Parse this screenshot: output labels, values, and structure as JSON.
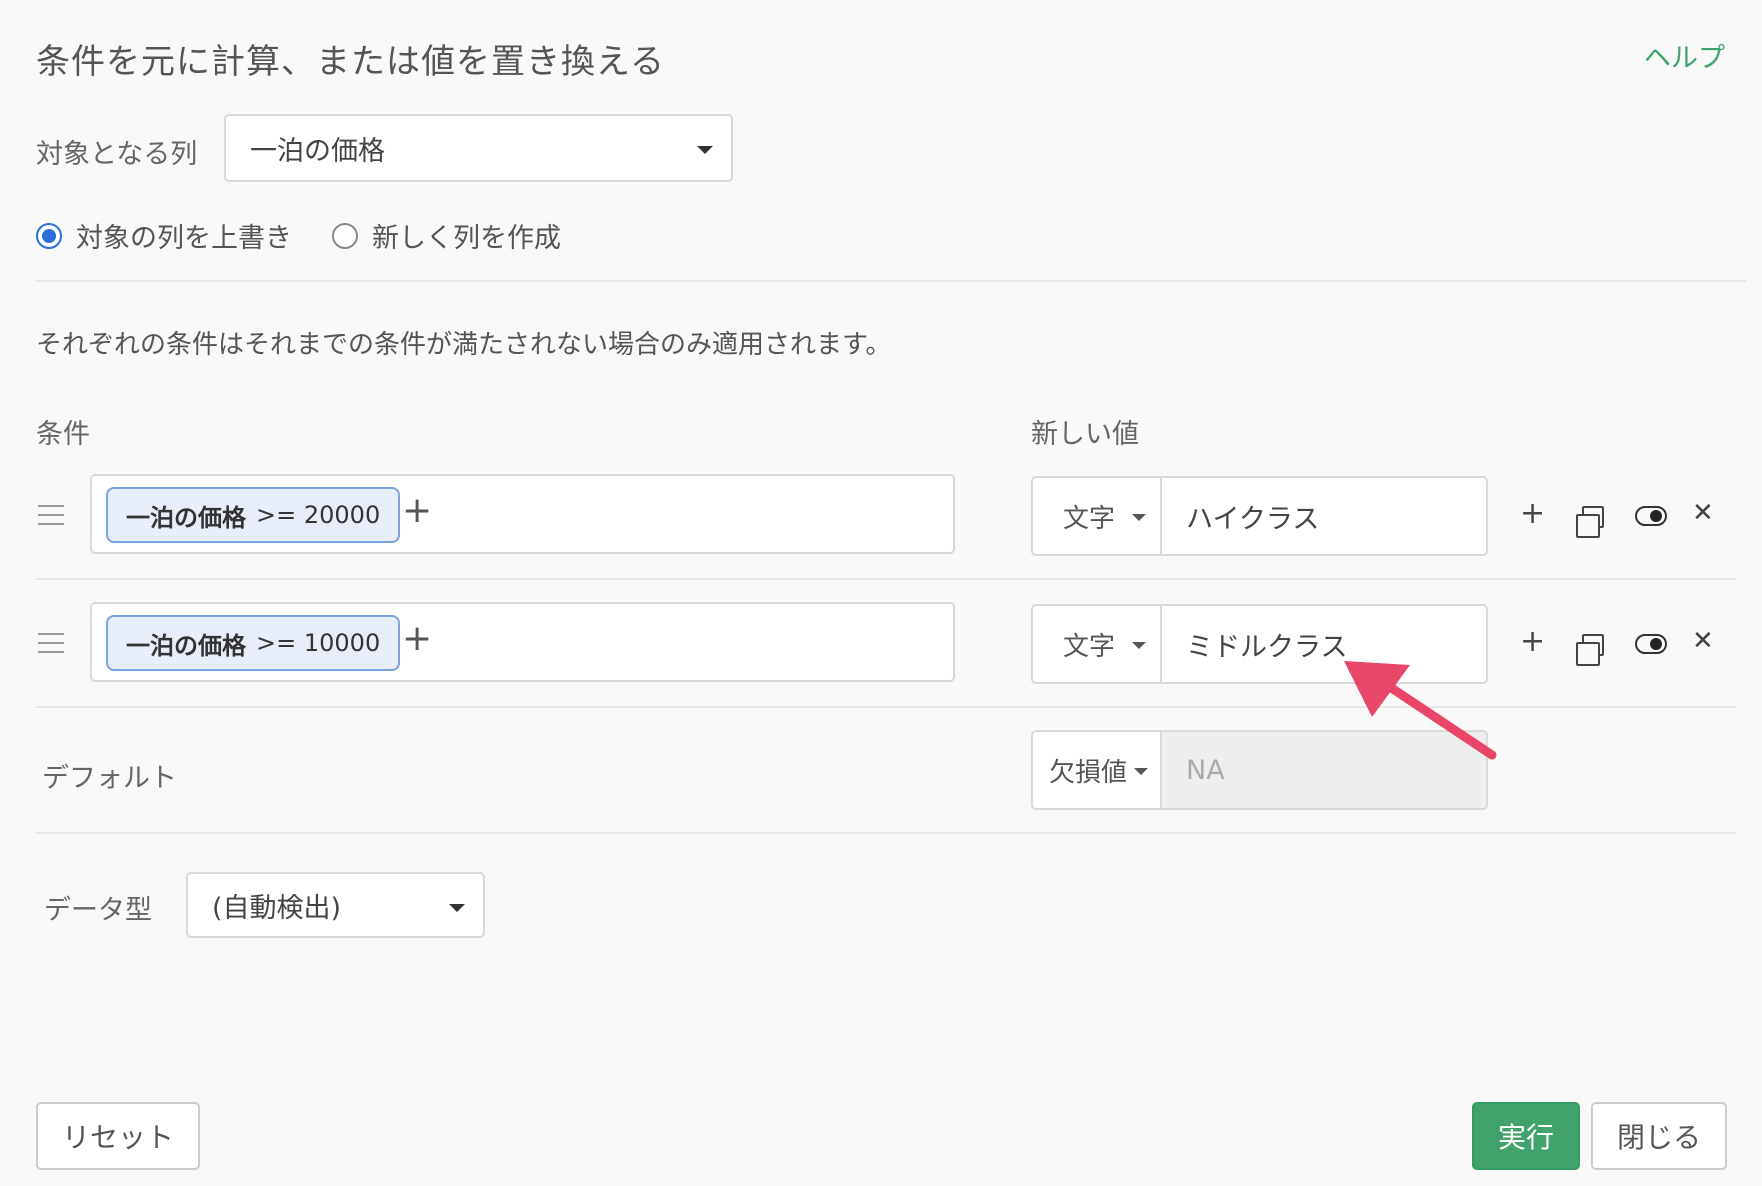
{
  "dialog": {
    "title": "条件を元に計算、または値を置き換える",
    "help_label": "ヘルプ"
  },
  "target_column": {
    "label": "対象となる列",
    "selected": "一泊の価格"
  },
  "output_mode": {
    "options": [
      {
        "label": "対象の列を上書き",
        "checked": true
      },
      {
        "label": "新しく列を作成",
        "checked": false
      }
    ]
  },
  "note": "それぞれの条件はそれまでの条件が満たされない場合のみ適用されます。",
  "headers": {
    "condition": "条件",
    "new_value": "新しい値"
  },
  "rules": [
    {
      "column": "一泊の価格",
      "operator": ">=",
      "operand": "20000",
      "value_type": "文字",
      "value": "ハイクラス"
    },
    {
      "column": "一泊の価格",
      "operator": ">=",
      "operand": "10000",
      "value_type": "文字",
      "value": "ミドルクラス"
    }
  ],
  "default": {
    "label": "デフォルト",
    "value_type": "欠損値",
    "value": "NA"
  },
  "data_type": {
    "label": "データ型",
    "selected": "(自動検出)"
  },
  "actions": {
    "add": "+",
    "remove": "✕",
    "add_condition": "+"
  },
  "footer": {
    "reset_label": "リセット",
    "run_label": "実行",
    "close_label": "閉じる"
  },
  "colors": {
    "accent_green": "#41a26c",
    "chip_border": "#7ca4dc",
    "radio_blue": "#2b6fdb",
    "annotation_arrow": "#e8476a"
  }
}
